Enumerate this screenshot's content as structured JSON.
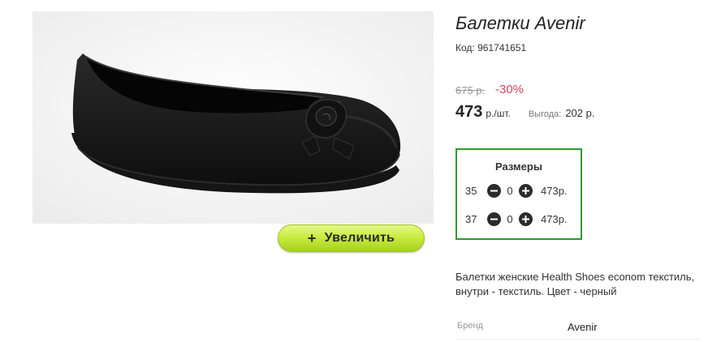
{
  "product": {
    "title": "Балетки Avenir",
    "code": "Код: 961741651",
    "image_icon": "shoe-photo"
  },
  "pricing": {
    "old_price": "675 р.",
    "discount": "-30%",
    "price": "473",
    "price_unit": "р./шт.",
    "benefit_label": "Выгода:",
    "benefit_value": "202 р."
  },
  "zoom": {
    "icon": "plus-icon",
    "plus": "+",
    "label": "Увеличить",
    "colors": {
      "start": "#e4f98a",
      "end": "#a5d11d"
    }
  },
  "sizes": {
    "title": "Размеры",
    "border_color": "#2e9a2e",
    "rows": [
      {
        "size": "35",
        "qty": "0",
        "price": "473р."
      },
      {
        "size": "37",
        "qty": "0",
        "price": "473р."
      }
    ],
    "icons": {
      "decrease": "minus-circle-icon",
      "increase": "plus-circle-icon"
    }
  },
  "description": {
    "text": "Балетки женские Health Shoes econom текстиль, внутри - текстиль. Цвет - черный"
  },
  "brand": {
    "label": "Бренд",
    "value": "Avenir"
  },
  "colors": {
    "discount": "#d4435d",
    "accent_green": "#2e9a2e"
  }
}
